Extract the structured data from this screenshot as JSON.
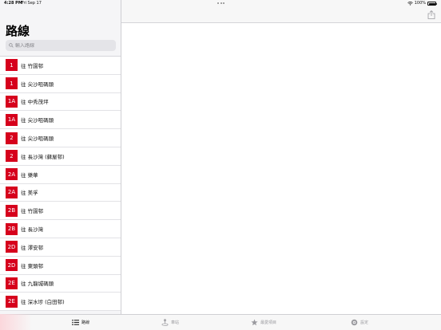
{
  "status_bar": {
    "time": "4:28 PM",
    "date": "Fri Sep 17",
    "battery": "100%"
  },
  "sidebar": {
    "title": "路線",
    "search_placeholder": "輸入路線",
    "routes": [
      {
        "number": "1",
        "destination": "往 竹園邨"
      },
      {
        "number": "1",
        "destination": "往 尖沙咀碼頭"
      },
      {
        "number": "1A",
        "destination": "往 中秀茂坪"
      },
      {
        "number": "1A",
        "destination": "往 尖沙咀碼頭"
      },
      {
        "number": "2",
        "destination": "往 尖沙咀碼頭"
      },
      {
        "number": "2",
        "destination": "往 長沙灣 (蘇屋邨)"
      },
      {
        "number": "2A",
        "destination": "往 樂華"
      },
      {
        "number": "2A",
        "destination": "往 美孚"
      },
      {
        "number": "2B",
        "destination": "往 竹園邨"
      },
      {
        "number": "2B",
        "destination": "往 長沙灣"
      },
      {
        "number": "2D",
        "destination": "往 澤安邨"
      },
      {
        "number": "2D",
        "destination": "往 東頭邨"
      },
      {
        "number": "2E",
        "destination": "往 九龍城碼頭"
      },
      {
        "number": "2E",
        "destination": "往 深水埗 (白田邨)"
      }
    ]
  },
  "tabbar": {
    "routes": "路線",
    "stops": "車站",
    "favorites": "最愛項目",
    "settings": "設定"
  },
  "colors": {
    "route_badge": "#d6001c",
    "accent": "#000000"
  }
}
